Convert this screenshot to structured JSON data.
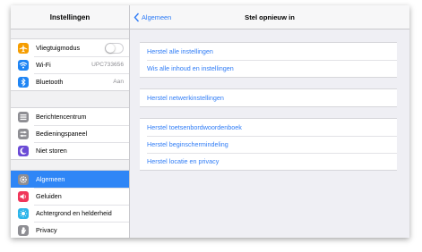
{
  "left_panel": {
    "title": "Instellingen",
    "groups": [
      {
        "items": [
          {
            "label": "Vliegtuigmodus",
            "icon": "airplane-icon",
            "icon_color": "#f59d00",
            "value": ""
          },
          {
            "label": "Wi-Fi",
            "icon": "wifi-icon",
            "icon_color": "#1f85f4",
            "value": "UPC733656"
          },
          {
            "label": "Bluetooth",
            "icon": "bluetooth-icon",
            "icon_color": "#1f85f4",
            "value": "Aan"
          }
        ]
      },
      {
        "items": [
          {
            "label": "Berichtencentrum",
            "icon": "notifications-icon",
            "icon_color": "#8e8e93"
          },
          {
            "label": "Bedieningspaneel",
            "icon": "control-center-icon",
            "icon_color": "#8e8e93"
          },
          {
            "label": "Niet storen",
            "icon": "moon-icon",
            "icon_color": "#6b4bd6"
          }
        ]
      },
      {
        "items": [
          {
            "label": "Algemeen",
            "icon": "gear-icon",
            "icon_color": "#8e8e93",
            "selected": true
          },
          {
            "label": "Geluiden",
            "icon": "speaker-icon",
            "icon_color": "#f0365a"
          },
          {
            "label": "Achtergrond en helderheid",
            "icon": "brightness-icon",
            "icon_color": "#2cb5ea"
          },
          {
            "label": "Privacy",
            "icon": "hand-icon",
            "icon_color": "#8e8e93"
          }
        ]
      }
    ],
    "airplane_mode_on": false
  },
  "right_panel": {
    "back_label": "Algemeen",
    "title": "Stel opnieuw in",
    "sections": [
      [
        "Herstel alle instellingen",
        "Wis alle inhoud en instellingen"
      ],
      [
        "Herstel netwerkinstellingen"
      ],
      [
        "Herstel toetsenbordwoordenboek",
        "Herstel beginschermindeling",
        "Herstel locatie en privacy"
      ]
    ]
  },
  "colors": {
    "accent": "#2f7cf6",
    "selected_row": "#2f86f6"
  }
}
